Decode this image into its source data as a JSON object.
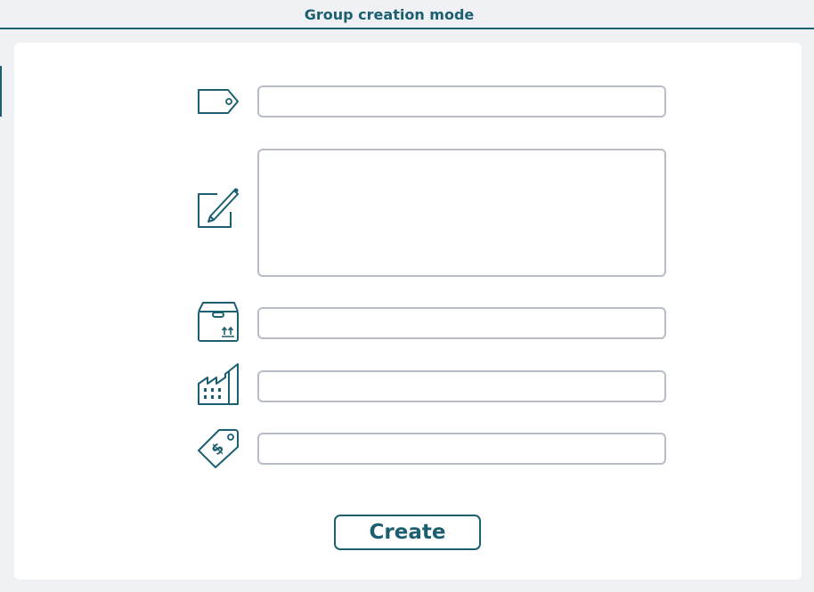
{
  "header": {
    "title": "Group creation mode"
  },
  "form": {
    "name_field": {
      "value": "",
      "placeholder": ""
    },
    "description_field": {
      "value": "",
      "placeholder": ""
    },
    "package_field": {
      "value": "",
      "placeholder": ""
    },
    "manufacturer_field": {
      "value": "",
      "placeholder": ""
    },
    "price_field": {
      "value": "",
      "placeholder": ""
    }
  },
  "icons": {
    "name": "tag-icon",
    "description": "edit-pencil-icon",
    "package": "box-icon",
    "manufacturer": "factory-icon",
    "price": "price-tag-icon"
  },
  "actions": {
    "create_label": "Create"
  },
  "colors": {
    "accent": "#1c5f71",
    "background": "#eff1f5",
    "panel": "#ffffff",
    "field_border": "#b9bdc8"
  }
}
